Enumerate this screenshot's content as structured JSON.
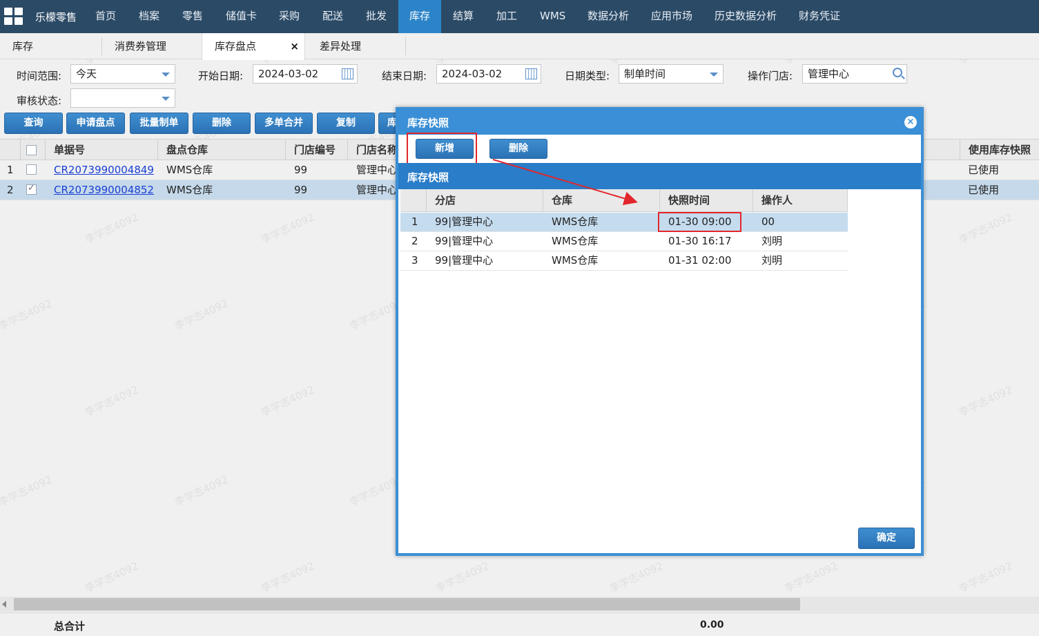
{
  "app": {
    "title": "乐檬零售"
  },
  "nav": {
    "items": [
      "首页",
      "档案",
      "零售",
      "储值卡",
      "采购",
      "配送",
      "批发",
      "库存",
      "结算",
      "加工",
      "WMS",
      "数据分析",
      "应用市场",
      "历史数据分析",
      "财务凭证"
    ],
    "active": "库存"
  },
  "tabs": {
    "items": [
      "库存",
      "消费券管理",
      "库存盘点",
      "差异处理"
    ],
    "active": "库存盘点",
    "close_glyph": "×"
  },
  "filters": {
    "time_range_label": "时间范围:",
    "time_range_value": "今天",
    "start_date_label": "开始日期:",
    "start_date_value": "2024-03-02",
    "end_date_label": "结束日期:",
    "end_date_value": "2024-03-02",
    "date_type_label": "日期类型:",
    "date_type_value": "制单时间",
    "store_label": "操作门店:",
    "store_value": "管理中心",
    "audit_label": "审核状态:",
    "audit_value": ""
  },
  "toolbar": {
    "buttons": [
      "查询",
      "申请盘点",
      "批量制单",
      "删除",
      "多单合并",
      "复制",
      "库"
    ]
  },
  "grid": {
    "columns": [
      "单据号",
      "盘点仓库",
      "门店编号",
      "门店名称",
      "使用库存快照"
    ],
    "rows": [
      {
        "num": "1",
        "checked": false,
        "doc_no": "CR2073990004849",
        "warehouse": "WMS仓库",
        "store_code": "99",
        "store_name": "管理中心",
        "use_snapshot": "已使用"
      },
      {
        "num": "2",
        "checked": true,
        "doc_no": "CR2073990004852",
        "warehouse": "WMS仓库",
        "store_code": "99",
        "store_name": "管理中心",
        "use_snapshot": "已使用"
      }
    ]
  },
  "footer": {
    "total_label": "总合计",
    "total_value": "0.00"
  },
  "modal": {
    "title": "库存快照",
    "add_button": "新增",
    "delete_button": "删除",
    "section_title": "库存快照",
    "columns": [
      "分店",
      "仓库",
      "快照时间",
      "操作人"
    ],
    "rows": [
      {
        "num": "1",
        "branch": "99|管理中心",
        "warehouse": "WMS仓库",
        "time": "01-30 09:00",
        "operator": "00"
      },
      {
        "num": "2",
        "branch": "99|管理中心",
        "warehouse": "WMS仓库",
        "time": "01-30 16:17",
        "operator": "刘明"
      },
      {
        "num": "3",
        "branch": "99|管理中心",
        "warehouse": "WMS仓库",
        "time": "01-31 02:00",
        "operator": "刘明"
      }
    ],
    "ok_button": "确定",
    "close_glyph": "×"
  },
  "watermark": "李学志4092",
  "colors": {
    "nav_bg": "#2b4a66",
    "accent": "#2c84c8",
    "highlight_red": "#e2262b",
    "selected_row": "#c5d9ea"
  }
}
